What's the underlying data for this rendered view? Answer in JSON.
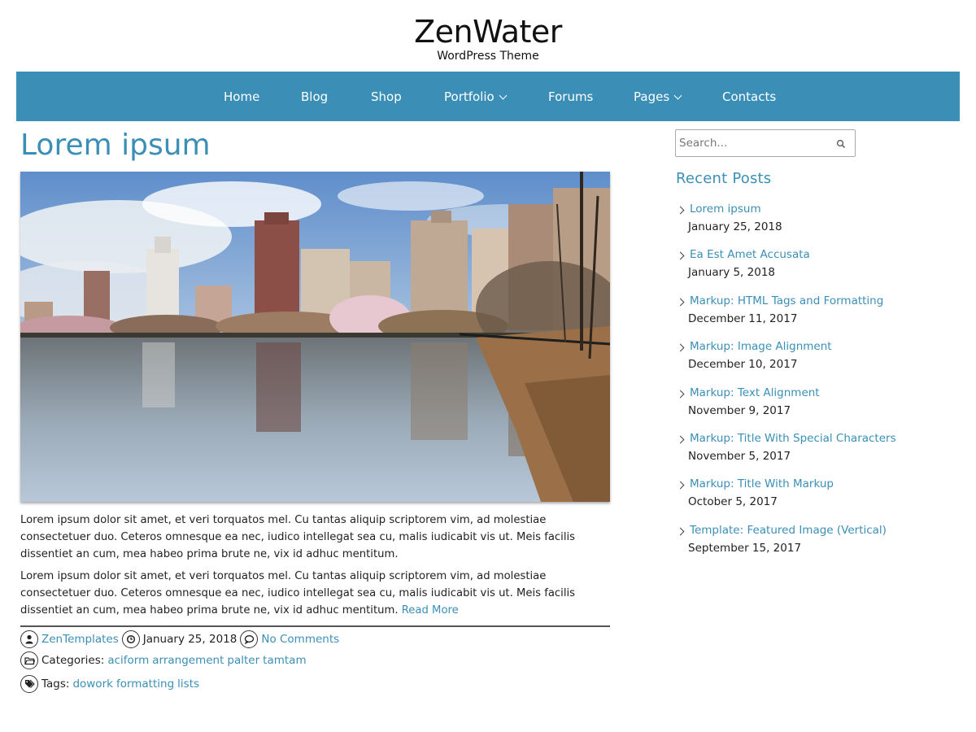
{
  "site": {
    "title": "ZenWater",
    "description": "WordPress Theme"
  },
  "nav": {
    "items": [
      {
        "label": "Home"
      },
      {
        "label": "Blog"
      },
      {
        "label": "Shop"
      },
      {
        "label": "Portfolio",
        "has_dropdown": true
      },
      {
        "label": "Forums"
      },
      {
        "label": "Pages",
        "has_dropdown": true
      },
      {
        "label": "Contacts"
      }
    ]
  },
  "post": {
    "title": "Lorem ipsum",
    "featured_image": "city skyline reflected in reservoir lake with trees",
    "paragraphs": [
      "Lorem ipsum dolor sit amet, et veri torquatos mel. Cu tantas aliquip scriptorem vim, ad molestiae consectetuer duo. Ceteros omnesque ea nec, iudico intellegat sea cu, malis iudicabit vis ut. Meis facilis dissentiet an cum, mea habeo prima brute ne, vix id adhuc mentitum.",
      "Lorem ipsum dolor sit amet, et veri torquatos mel. Cu tantas aliquip scriptorem vim, ad molestiae consectetuer duo. Ceteros omnesque ea nec, iudico intellegat sea cu, malis iudicabit vis ut. Meis facilis dissentiet an cum, mea habeo prima brute ne, vix id adhuc mentitum."
    ],
    "read_more": "Read More",
    "meta": {
      "author": "ZenTemplates",
      "date": "January 25, 2018",
      "comments": "No Comments",
      "categories_label": "Categories:",
      "categories": [
        "aciform",
        "arrangement",
        "palter",
        "tamtam"
      ],
      "tags_label": "Tags:",
      "tags": [
        "dowork",
        "formatting",
        "lists"
      ]
    }
  },
  "sidebar": {
    "search_placeholder": "Search...",
    "recent_posts_title": "Recent Posts",
    "recent_posts": [
      {
        "title": "Lorem ipsum",
        "date": "January 25, 2018"
      },
      {
        "title": "Ea Est Amet Accusata",
        "date": "January 5, 2018"
      },
      {
        "title": "Markup: HTML Tags and Formatting",
        "date": "December 11, 2017"
      },
      {
        "title": "Markup: Image Alignment",
        "date": "December 10, 2017"
      },
      {
        "title": "Markup: Text Alignment",
        "date": "November 9, 2017"
      },
      {
        "title": "Markup: Title With Special Characters",
        "date": "November 5, 2017"
      },
      {
        "title": "Markup: Title With Markup",
        "date": "October 5, 2017"
      },
      {
        "title": "Template: Featured Image (Vertical)",
        "date": "September 15, 2017"
      }
    ]
  },
  "colors": {
    "accent": "#3b8fb6",
    "nav_background": "#3b8fb6",
    "text": "#222222"
  },
  "icons": {
    "author": "user-icon",
    "date": "clock-icon",
    "comments": "comment-icon",
    "categories": "folder-icon",
    "tags": "tags-icon",
    "search": "search-icon"
  }
}
